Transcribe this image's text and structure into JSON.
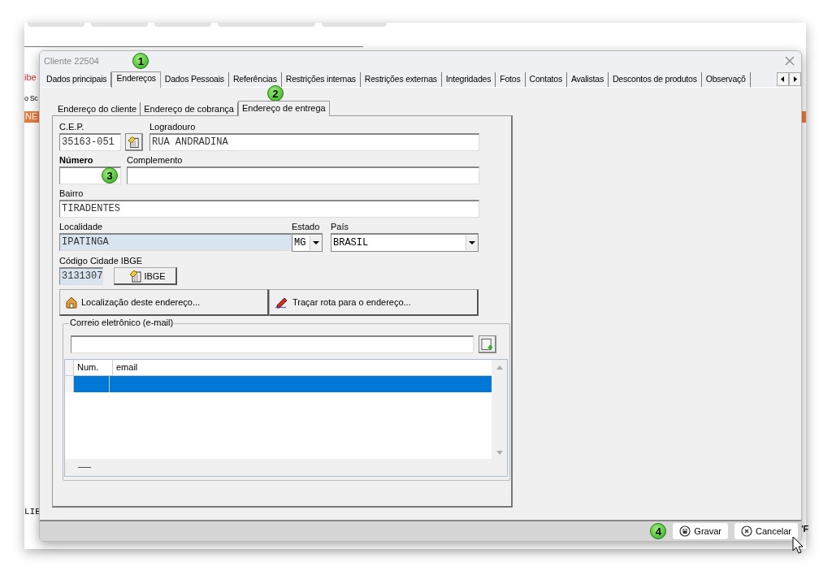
{
  "background": {
    "red_label": "ibe",
    "side_label": "o Sc",
    "band_label": "NE",
    "code_label": "LIE",
    "edge_label": "'F"
  },
  "dialog": {
    "title": "Cliente 22504",
    "tabs": [
      {
        "label": "Dados principais",
        "selected": false
      },
      {
        "label": "Endereços",
        "selected": true,
        "marker": "1"
      },
      {
        "label": "Dados Pessoais",
        "selected": false
      },
      {
        "label": "Referências",
        "selected": false
      },
      {
        "label": "Restrições internas",
        "selected": false
      },
      {
        "label": "Restrições externas",
        "selected": false
      },
      {
        "label": "Integridades",
        "selected": false
      },
      {
        "label": "Fotos",
        "selected": false
      },
      {
        "label": "Contatos",
        "selected": false
      },
      {
        "label": "Avalistas",
        "selected": false
      },
      {
        "label": "Descontos de produtos",
        "selected": false
      },
      {
        "label": "Observaçõ",
        "selected": false
      }
    ],
    "subtabs": [
      {
        "label": "Endereço do cliente",
        "selected": false
      },
      {
        "label": "Endereço de cobrança",
        "selected": false
      },
      {
        "label": "Endereço de entrega",
        "selected": true,
        "marker": "2"
      }
    ],
    "fields": {
      "cep": {
        "label": "C.E.P.",
        "value": "35163-051",
        "required": false,
        "readonly": false
      },
      "logradouro": {
        "label": "Logradouro",
        "value": "RUA ANDRADINA",
        "required": false,
        "readonly": false
      },
      "numero": {
        "label": "Número",
        "required": true,
        "readonly": false,
        "marker": "3"
      },
      "complemento": {
        "label": "Complemento",
        "required": false,
        "readonly": false
      },
      "bairro": {
        "label": "Bairro",
        "value": "TIRADENTES",
        "required": false,
        "readonly": false
      },
      "localidade": {
        "label": "Localidade",
        "value": "IPATINGA",
        "required": false,
        "readonly": true
      },
      "estado": {
        "label": "Estado",
        "value": "MG",
        "required": false,
        "readonly": false
      },
      "pais": {
        "label": "País",
        "value": "BRASIL",
        "required": false,
        "readonly": false
      },
      "ibge": {
        "label": "Código Cidade IBGE",
        "value": "3131307",
        "required": false,
        "readonly": true
      }
    },
    "ibge_button": "IBGE",
    "location_button": "Localização deste endereço...",
    "route_button": "Traçar rota para o endereço...",
    "email": {
      "title": "Correio eletrônico (e-mail)",
      "columns": [
        "Num.",
        "email"
      ],
      "rows": [
        {
          "selected": true
        }
      ]
    },
    "buttons": [
      {
        "kind": "save",
        "label": "Gravar",
        "marker": "4"
      },
      {
        "kind": "cancel",
        "label": "Cancelar"
      }
    ]
  }
}
